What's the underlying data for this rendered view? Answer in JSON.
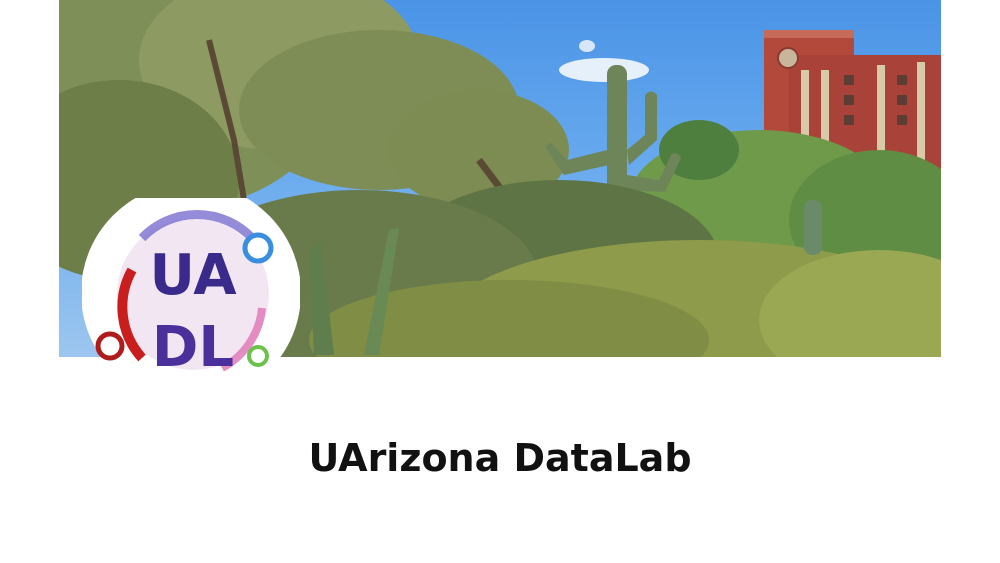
{
  "profile": {
    "name": "UArizona DataLab",
    "logo_text_top": "UA",
    "logo_text_bottom": "DL"
  },
  "colors": {
    "sky": "#4a93e6",
    "brick": "#b0473a",
    "foliage": "#6f8a4a",
    "logo_purple": "#3a2a8c",
    "logo_red": "#b01c1c",
    "logo_blue": "#3a8ee0",
    "logo_green": "#6cc24a"
  },
  "icons": {
    "banner": "cover-photo-desert-garden",
    "logo": "uadl-logo-icon"
  }
}
